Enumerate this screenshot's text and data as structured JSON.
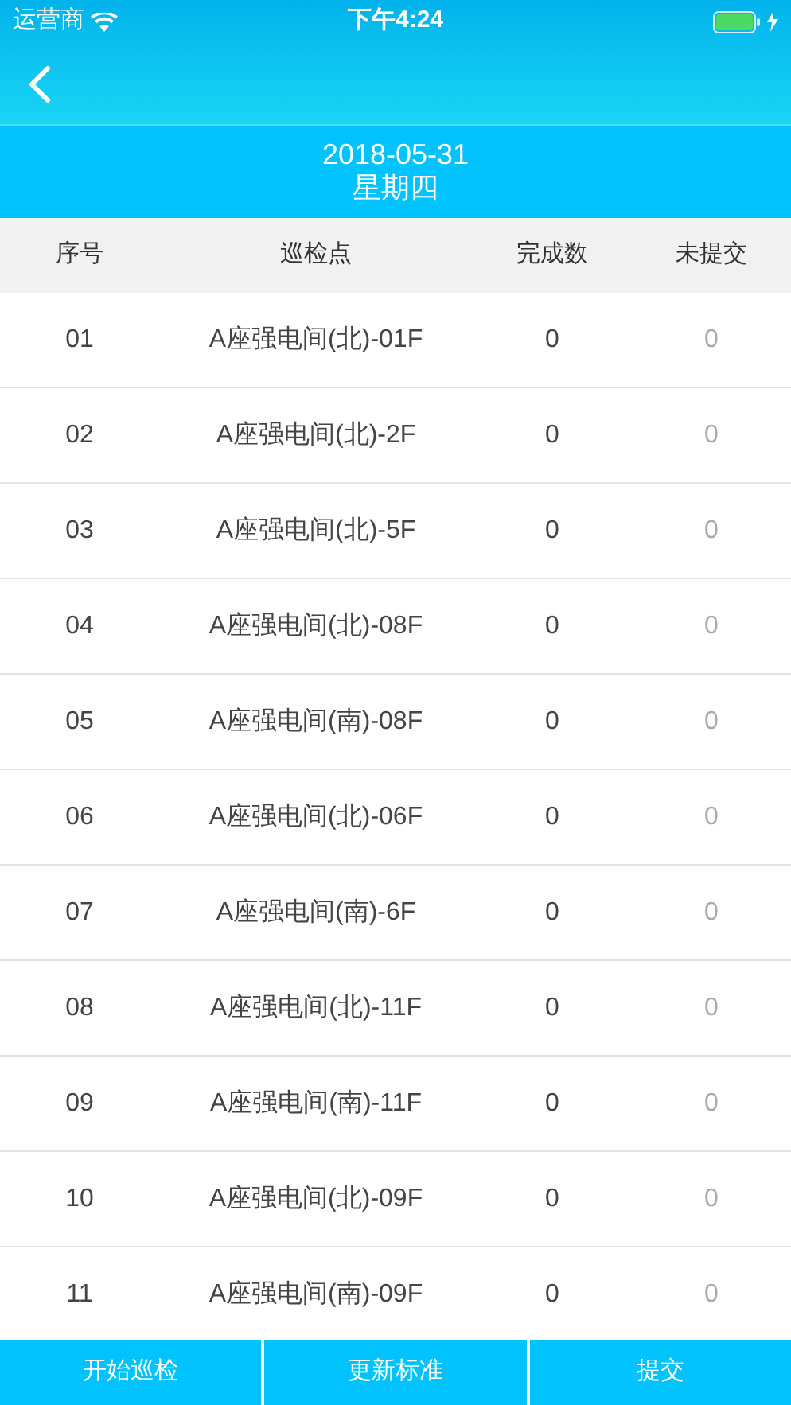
{
  "status_bar": {
    "carrier": "运营商",
    "time": "下午4:24"
  },
  "date_header": {
    "date": "2018-05-31",
    "weekday": "星期四"
  },
  "table": {
    "columns": [
      "序号",
      "巡检点",
      "完成数",
      "未提交"
    ],
    "rows": [
      {
        "index": "01",
        "point": "A座强电间(北)-01F",
        "done": "0",
        "unsubmitted": "0"
      },
      {
        "index": "02",
        "point": "A座强电间(北)-2F",
        "done": "0",
        "unsubmitted": "0"
      },
      {
        "index": "03",
        "point": "A座强电间(北)-5F",
        "done": "0",
        "unsubmitted": "0"
      },
      {
        "index": "04",
        "point": "A座强电间(北)-08F",
        "done": "0",
        "unsubmitted": "0"
      },
      {
        "index": "05",
        "point": "A座强电间(南)-08F",
        "done": "0",
        "unsubmitted": "0"
      },
      {
        "index": "06",
        "point": "A座强电间(北)-06F",
        "done": "0",
        "unsubmitted": "0"
      },
      {
        "index": "07",
        "point": "A座强电间(南)-6F",
        "done": "0",
        "unsubmitted": "0"
      },
      {
        "index": "08",
        "point": "A座强电间(北)-11F",
        "done": "0",
        "unsubmitted": "0"
      },
      {
        "index": "09",
        "point": "A座强电间(南)-11F",
        "done": "0",
        "unsubmitted": "0"
      },
      {
        "index": "10",
        "point": "A座强电间(北)-09F",
        "done": "0",
        "unsubmitted": "0"
      },
      {
        "index": "11",
        "point": "A座强电间(南)-09F",
        "done": "0",
        "unsubmitted": "0"
      }
    ]
  },
  "bottom_buttons": [
    "开始巡检",
    "更新标准",
    "提交"
  ]
}
